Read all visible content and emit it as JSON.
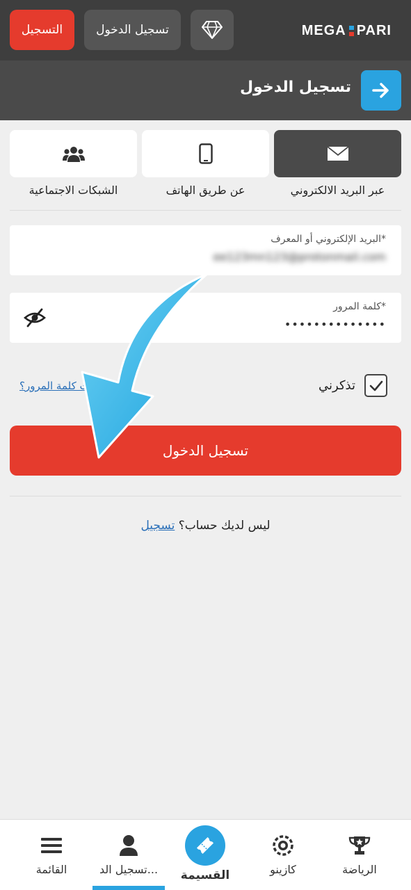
{
  "header": {
    "register_label": "التسجيل",
    "login_label": "تسجيل الدخول",
    "logo_left": "MEGA",
    "logo_right": "PARI"
  },
  "subheader": {
    "title": "تسجيل الدخول"
  },
  "tabs": [
    {
      "label": "عبر البريد الالكتروني",
      "icon": "envelope-icon",
      "active": true
    },
    {
      "label": "عن طريق الهاتف",
      "icon": "phone-icon",
      "active": false
    },
    {
      "label": "الشبكات الاجتماعية",
      "icon": "people-icon",
      "active": false
    }
  ],
  "form": {
    "email_label": "البريد الإلكتروني أو المعرف*",
    "email_value": "ee123mn123@protonmail.com",
    "password_label": "كلمة المرور*",
    "password_value": "••••••••••••••",
    "remember_label": "تذكرني",
    "forgot_label": "نسيت كلمة المرور؟",
    "submit_label": "تسجيل الدخول"
  },
  "footer_prompt": {
    "text": "ليس لديك حساب؟",
    "link": "تسجيل"
  },
  "bottom_nav": {
    "sports": "الرياضة",
    "casino": "كازينو",
    "coupon": "القسيمة",
    "login": "تسجيل الد...",
    "menu": "القائمة"
  },
  "colors": {
    "accent_red": "#e53b2d",
    "accent_blue": "#2aa3e0",
    "dark": "#3e3e3e"
  }
}
